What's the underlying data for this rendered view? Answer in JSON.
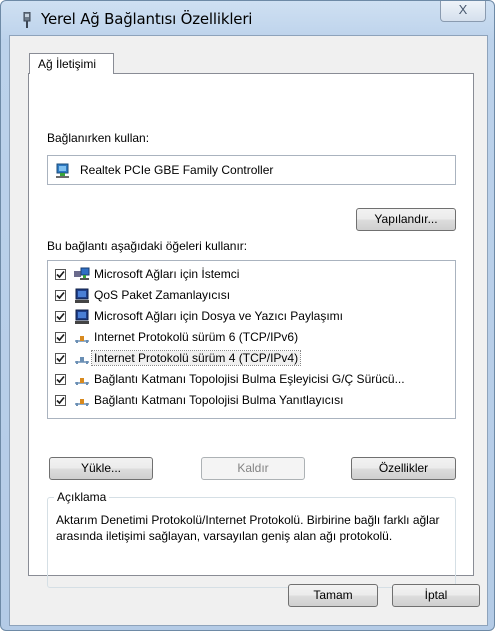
{
  "window": {
    "title": "Yerel Ağ Bağlantısı Özellikleri",
    "close_symbol": "X"
  },
  "tab": {
    "label": "Ağ İletişimi"
  },
  "connect_using": {
    "label": "Bağlanırken kullan:",
    "adapter": "Realtek PCIe GBE Family Controller",
    "adapter_icon": "network-adapter-icon",
    "configure_button": "Yapılandır..."
  },
  "items_section": {
    "label": "Bu bağlantı aşağıdaki öğeleri kullanır:",
    "items": [
      {
        "label": "Microsoft Ağları için İstemci",
        "checked": true,
        "icon": "network-client-icon"
      },
      {
        "label": "QoS Paket Zamanlayıcısı",
        "checked": true,
        "icon": "service-icon"
      },
      {
        "label": "Microsoft Ağları için Dosya ve Yazıcı Paylaşımı",
        "checked": true,
        "icon": "service-icon"
      },
      {
        "label": "Internet Protokolü sürüm 6 (TCP/IPv6)",
        "checked": true,
        "icon": "protocol-icon"
      },
      {
        "label": "Internet Protokolü sürüm 4 (TCP/IPv4)",
        "checked": true,
        "icon": "protocol-icon",
        "selected": true
      },
      {
        "label": "Bağlantı Katmanı Topolojisi Bulma Eşleyicisi G/Ç Sürücü...",
        "checked": true,
        "icon": "protocol-icon"
      },
      {
        "label": "Bağlantı Katmanı Topolojisi Bulma Yanıtlayıcısı",
        "checked": true,
        "icon": "protocol-icon"
      }
    ]
  },
  "item_buttons": {
    "install": "Yükle...",
    "uninstall": "Kaldır",
    "properties": "Özellikler"
  },
  "description": {
    "title": "Açıklama",
    "text": "Aktarım Denetimi Protokolü/Internet Protokolü. Birbirine bağlı farklı ağlar arasında iletişimi sağlayan, varsayılan geniş alan ağı protokolü."
  },
  "footer": {
    "ok": "Tamam",
    "cancel": "İptal"
  }
}
